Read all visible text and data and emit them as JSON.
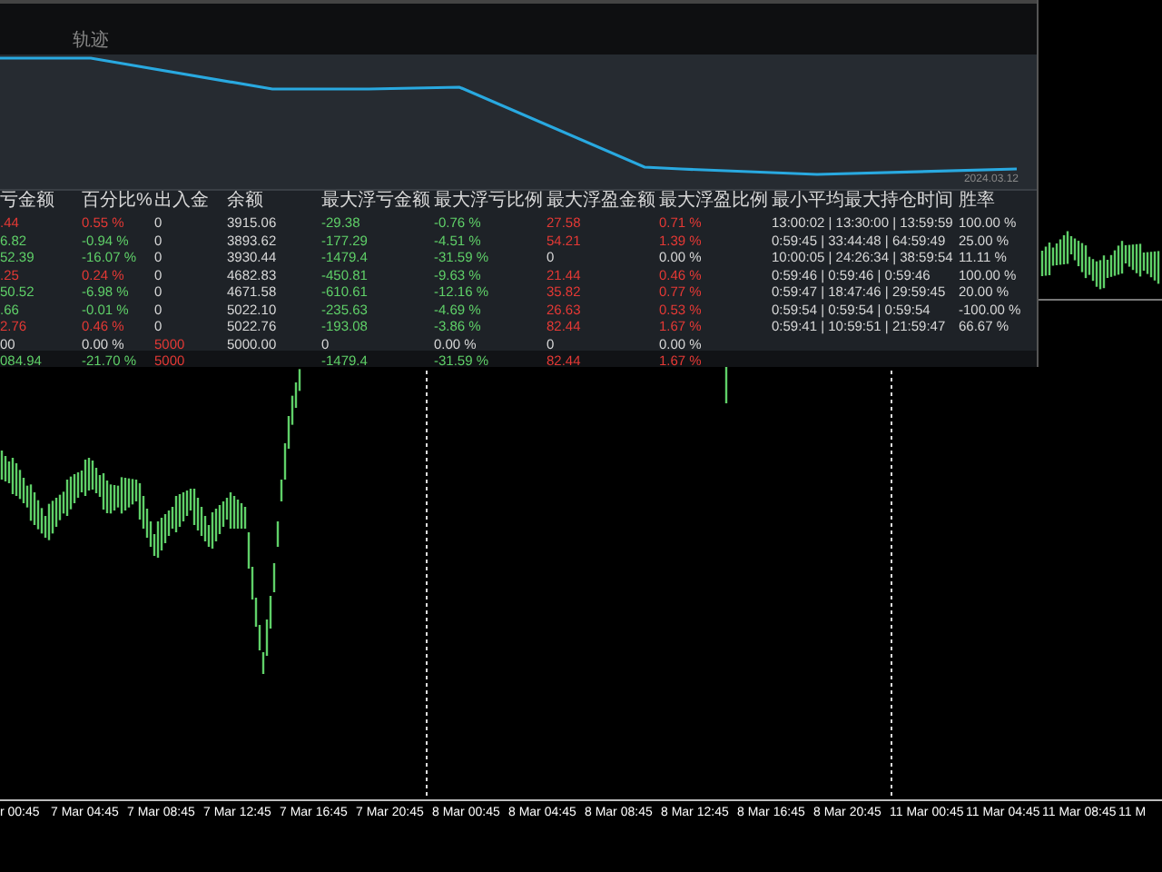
{
  "panel": {
    "title": "轨迹",
    "curve_date": "2024.03.12",
    "table": {
      "columns": [
        "亏金额",
        "百分比%",
        "出入金",
        "余额",
        "最大浮亏金额",
        "最大浮亏比例",
        "最大浮盈金额",
        "最大浮盈比例",
        "最小平均最大持仓时间",
        "胜率"
      ],
      "rows": [
        {
          "kind": "data",
          "cells": [
            {
              "text": ".44",
              "color": "#e53935"
            },
            {
              "text": "0.55 %",
              "color": "#e53935"
            },
            {
              "text": "0"
            },
            {
              "text": "3915.06"
            },
            {
              "text": "-29.38",
              "color": "#5fd068"
            },
            {
              "text": "-0.76 %",
              "color": "#5fd068"
            },
            {
              "text": "27.58",
              "color": "#e53935"
            },
            {
              "text": "0.71 %",
              "color": "#e53935"
            },
            {
              "text": "13:00:02 | 13:30:00 | 13:59:59"
            },
            {
              "text": "100.00 %"
            }
          ]
        },
        {
          "kind": "data",
          "cells": [
            {
              "text": "6.82",
              "color": "#5fd068"
            },
            {
              "text": "-0.94 %",
              "color": "#5fd068"
            },
            {
              "text": "0"
            },
            {
              "text": "3893.62"
            },
            {
              "text": "-177.29",
              "color": "#5fd068"
            },
            {
              "text": "-4.51 %",
              "color": "#5fd068"
            },
            {
              "text": "54.21",
              "color": "#e53935"
            },
            {
              "text": "1.39 %",
              "color": "#e53935"
            },
            {
              "text": "0:59:45 | 33:44:48 | 64:59:49"
            },
            {
              "text": "25.00 %"
            }
          ]
        },
        {
          "kind": "data",
          "cells": [
            {
              "text": "52.39",
              "color": "#5fd068"
            },
            {
              "text": "-16.07 %",
              "color": "#5fd068"
            },
            {
              "text": "0"
            },
            {
              "text": "3930.44"
            },
            {
              "text": "-1479.4",
              "color": "#5fd068"
            },
            {
              "text": "-31.59 %",
              "color": "#5fd068"
            },
            {
              "text": "0"
            },
            {
              "text": "0.00 %"
            },
            {
              "text": "10:00:05 | 24:26:34 | 38:59:54"
            },
            {
              "text": "11.11 %"
            }
          ]
        },
        {
          "kind": "data",
          "cells": [
            {
              "text": ".25",
              "color": "#e53935"
            },
            {
              "text": "0.24 %",
              "color": "#e53935"
            },
            {
              "text": "0"
            },
            {
              "text": "4682.83"
            },
            {
              "text": "-450.81",
              "color": "#5fd068"
            },
            {
              "text": "-9.63 %",
              "color": "#5fd068"
            },
            {
              "text": "21.44",
              "color": "#e53935"
            },
            {
              "text": "0.46 %",
              "color": "#e53935"
            },
            {
              "text": "0:59:46 | 0:59:46 | 0:59:46"
            },
            {
              "text": "100.00 %"
            }
          ]
        },
        {
          "kind": "data",
          "cells": [
            {
              "text": "50.52",
              "color": "#5fd068"
            },
            {
              "text": "-6.98 %",
              "color": "#5fd068"
            },
            {
              "text": "0"
            },
            {
              "text": "4671.58"
            },
            {
              "text": "-610.61",
              "color": "#5fd068"
            },
            {
              "text": "-12.16 %",
              "color": "#5fd068"
            },
            {
              "text": "35.82",
              "color": "#e53935"
            },
            {
              "text": "0.77 %",
              "color": "#e53935"
            },
            {
              "text": "0:59:47 | 18:47:46 | 29:59:45"
            },
            {
              "text": "20.00 %"
            }
          ]
        },
        {
          "kind": "data",
          "cells": [
            {
              "text": ".66",
              "color": "#5fd068"
            },
            {
              "text": "-0.01 %",
              "color": "#5fd068"
            },
            {
              "text": "0"
            },
            {
              "text": "5022.10"
            },
            {
              "text": "-235.63",
              "color": "#5fd068"
            },
            {
              "text": "-4.69 %",
              "color": "#5fd068"
            },
            {
              "text": "26.63",
              "color": "#e53935"
            },
            {
              "text": "0.53 %",
              "color": "#e53935"
            },
            {
              "text": "0:59:54 | 0:59:54 | 0:59:54"
            },
            {
              "text": "-100.00 %"
            }
          ]
        },
        {
          "kind": "data",
          "cells": [
            {
              "text": "2.76",
              "color": "#e53935"
            },
            {
              "text": "0.46 %",
              "color": "#e53935"
            },
            {
              "text": "0"
            },
            {
              "text": "5022.76"
            },
            {
              "text": "-193.08",
              "color": "#5fd068"
            },
            {
              "text": "-3.86 %",
              "color": "#5fd068"
            },
            {
              "text": "82.44",
              "color": "#e53935"
            },
            {
              "text": "1.67 %",
              "color": "#e53935"
            },
            {
              "text": "0:59:41 | 10:59:51 | 21:59:47"
            },
            {
              "text": "66.67 %"
            }
          ]
        },
        {
          "kind": "data",
          "cells": [
            {
              "text": "00"
            },
            {
              "text": "0.00 %"
            },
            {
              "text": "5000",
              "color": "#e53935"
            },
            {
              "text": "5000.00"
            },
            {
              "text": "0"
            },
            {
              "text": "0.00 %"
            },
            {
              "text": "0"
            },
            {
              "text": "0.00 %"
            },
            null,
            null
          ]
        },
        {
          "kind": "total",
          "cells": [
            {
              "text": "084.94",
              "color": "#5fd068"
            },
            {
              "text": "-21.70 %",
              "color": "#5fd068"
            },
            {
              "text": "5000",
              "color": "#e53935"
            },
            null,
            {
              "text": "-1479.4",
              "color": "#5fd068"
            },
            {
              "text": "-31.59 %",
              "color": "#5fd068"
            },
            {
              "text": "82.44",
              "color": "#e53935"
            },
            {
              "text": "1.67 %",
              "color": "#e53935"
            },
            null,
            null
          ]
        }
      ]
    }
  },
  "axis_labels": [
    "r 00:45",
    "7 Mar 04:45",
    "7 Mar 08:45",
    "7 Mar 12:45",
    "7 Mar 16:45",
    "7 Mar 20:45",
    "8 Mar 00:45",
    "8 Mar 04:45",
    "8 Mar 08:45",
    "8 Mar 12:45",
    "8 Mar 16:45",
    "8 Mar 20:45",
    "11 Mar 00:45",
    "11 Mar 04:45",
    "11 Mar 08:45",
    "11 M"
  ]
}
